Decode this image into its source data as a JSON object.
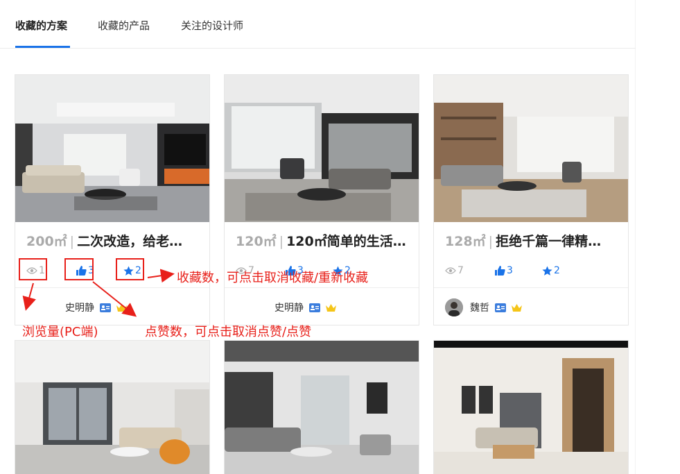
{
  "tabs": [
    {
      "label": "收藏的方案",
      "active": true
    },
    {
      "label": "收藏的产品",
      "active": false
    },
    {
      "label": "关注的设计师",
      "active": false
    }
  ],
  "cards": [
    {
      "area": "200㎡",
      "title": "二次改造，给老…",
      "views": "1",
      "likes": "3",
      "favs": "2",
      "author": "史明静"
    },
    {
      "area": "120㎡",
      "title": "120㎡简单的生活…",
      "views": "7",
      "likes": "3",
      "favs": "2",
      "author": "史明静"
    },
    {
      "area": "128㎡",
      "title": "拒绝千篇一律精…",
      "views": "7",
      "likes": "3",
      "favs": "2",
      "author": "魏哲"
    }
  ],
  "annotations": {
    "favs_note": "收藏数，可点击取消收藏/重新收藏",
    "views_note": "浏览量(PC端)",
    "likes_note": "点赞数，可点击取消点赞/点赞"
  },
  "colors": {
    "accent": "#1a73e8",
    "annotation": "#e8201a",
    "vip": "#f5c518"
  },
  "icons": {
    "views": "eye-icon",
    "likes": "thumbs-up-icon",
    "favs": "star-icon",
    "designer": "id-card-icon",
    "vip": "crown-icon"
  }
}
